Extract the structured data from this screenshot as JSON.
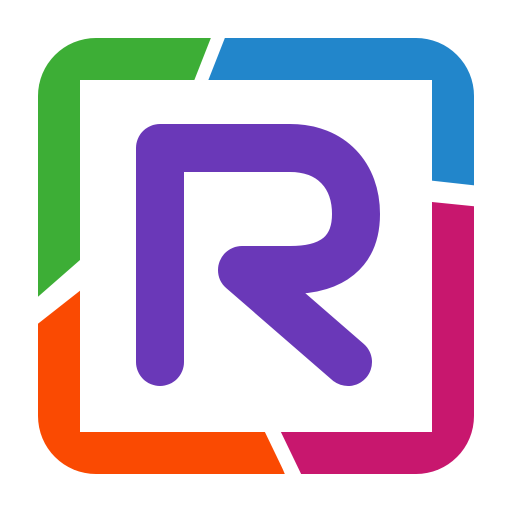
{
  "logo": {
    "icon": "letter-r-logo-icon",
    "letter": "R",
    "colors": {
      "green": "#3DAE36",
      "blue": "#2286CB",
      "magenta": "#C8176E",
      "orange": "#FA4A02",
      "purple": "#6A38B8",
      "inner_background": "#FFFFFF"
    }
  }
}
